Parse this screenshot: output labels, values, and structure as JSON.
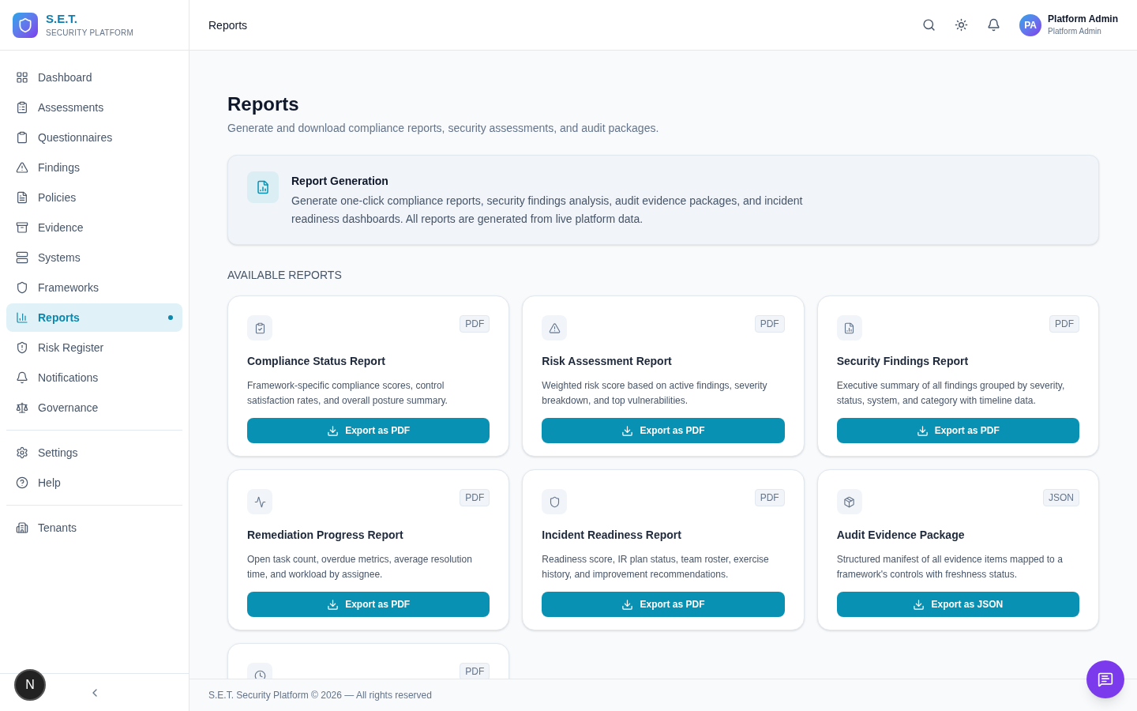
{
  "brand": {
    "name": "S.E.T.",
    "tagline": "SECURITY PLATFORM"
  },
  "sidebar": {
    "groups": [
      {
        "items": [
          {
            "label": "Dashboard",
            "selected": false
          },
          {
            "label": "Assessments",
            "selected": false
          },
          {
            "label": "Questionnaires",
            "selected": false
          },
          {
            "label": "Findings",
            "selected": false
          },
          {
            "label": "Policies",
            "selected": false
          },
          {
            "label": "Evidence",
            "selected": false
          },
          {
            "label": "Systems",
            "selected": false
          },
          {
            "label": "Frameworks",
            "selected": false
          },
          {
            "label": "Reports",
            "selected": true
          },
          {
            "label": "Risk Register",
            "selected": false
          },
          {
            "label": "Notifications",
            "selected": false
          },
          {
            "label": "Governance",
            "selected": false
          }
        ]
      },
      {
        "items": [
          {
            "label": "Settings",
            "selected": false
          },
          {
            "label": "Help",
            "selected": false
          }
        ]
      },
      {
        "items": [
          {
            "label": "Tenants",
            "selected": false
          }
        ]
      }
    ],
    "dev_badge": "N"
  },
  "header": {
    "title": "Reports",
    "user": {
      "initials": "PA",
      "name": "Platform Admin",
      "role": "Platform Admin"
    }
  },
  "page": {
    "title": "Reports",
    "subtitle": "Generate and download compliance reports, security assessments, and audit packages."
  },
  "info_card": {
    "title": "Report Generation",
    "text": "Generate one-click compliance reports, security findings analysis, audit evidence packages, and incident readiness dashboards. All reports are generated from live platform data."
  },
  "section_title": "AVAILABLE REPORTS",
  "reports": [
    {
      "format": "PDF",
      "title": "Compliance Status Report",
      "description": "Framework-specific compliance scores, control satisfaction rates, and overall posture summary.",
      "button": "Export as PDF"
    },
    {
      "format": "PDF",
      "title": "Risk Assessment Report",
      "description": "Weighted risk score based on active findings, severity breakdown, and top vulnerabilities.",
      "button": "Export as PDF"
    },
    {
      "format": "PDF",
      "title": "Security Findings Report",
      "description": "Executive summary of all findings grouped by severity, status, system, and category with timeline data.",
      "button": "Export as PDF"
    },
    {
      "format": "PDF",
      "title": "Remediation Progress Report",
      "description": "Open task count, overdue metrics, average resolution time, and workload by assignee.",
      "button": "Export as PDF"
    },
    {
      "format": "PDF",
      "title": "Incident Readiness Report",
      "description": "Readiness score, IR plan status, team roster, exercise history, and improvement recommendations.",
      "button": "Export as PDF"
    },
    {
      "format": "JSON",
      "title": "Audit Evidence Package",
      "description": "Structured manifest of all evidence items mapped to a framework's controls with freshness status.",
      "button": "Export as JSON"
    },
    {
      "format": "PDF"
    }
  ],
  "footer": "S.E.T. Security Platform © 2026 — All rights reserved"
}
